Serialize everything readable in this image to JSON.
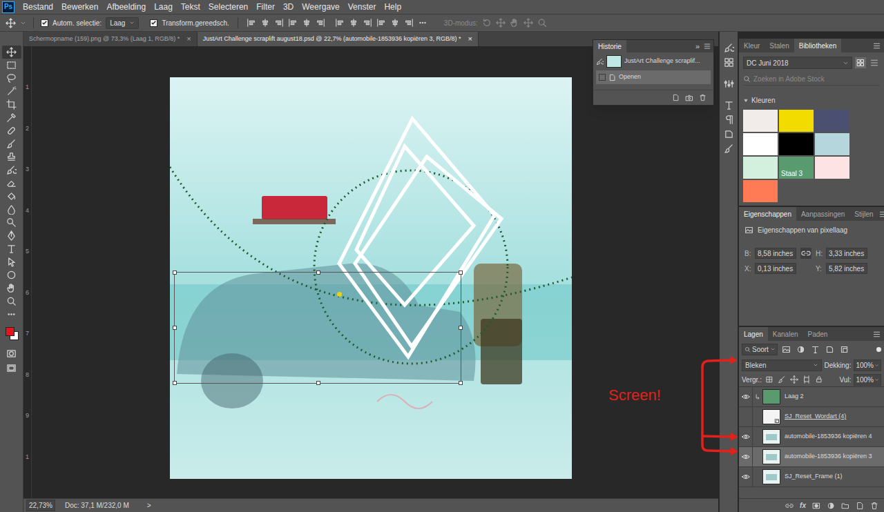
{
  "app": {
    "logo": "Ps"
  },
  "menu": [
    "Bestand",
    "Bewerken",
    "Afbeelding",
    "Laag",
    "Tekst",
    "Selecteren",
    "Filter",
    "3D",
    "Weergave",
    "Venster",
    "Help"
  ],
  "options_bar": {
    "auto_select": {
      "label": "Autom. selectie:",
      "checked": true
    },
    "target": "Laag",
    "transform_controls": {
      "label": "Transform.gereedsch.",
      "checked": true
    },
    "mode_3d": "3D-modus:"
  },
  "tool_colors": {
    "foreground": "#e8141b",
    "background": "#ffffff"
  },
  "document_tabs": [
    {
      "label": "Schermopname (159).png @ 73,3% (Laag 1, RGB/8) *",
      "close": "×",
      "selected": false
    },
    {
      "label": "JustArt Challenge scraplift august18.psd @ 22,7% (automobile-1853936 kopiëren 3, RGB/8) *",
      "close": "×",
      "selected": true
    }
  ],
  "ruler": [
    "1",
    "2",
    "3",
    "4",
    "5",
    "6",
    "7",
    "8",
    "9",
    "1"
  ],
  "history": {
    "title": "Historie",
    "collapse": "»",
    "items": [
      {
        "label": "JustArt Challenge scraplif...",
        "kind": "snapshot",
        "selected": false
      },
      {
        "label": "Openen",
        "kind": "state",
        "selected": true
      }
    ]
  },
  "status_bar": {
    "zoom": "22,73%",
    "document": "Doc: 37,1 M/232,0 M",
    "arrow": ">"
  },
  "libraries": {
    "tabs": [
      {
        "label": "Kleur",
        "selected": false
      },
      {
        "label": "Stalen",
        "selected": false
      },
      {
        "label": "Bibliotheken",
        "selected": true
      }
    ],
    "library": "DC Juni 2018",
    "search_placeholder": "Zoeken in Adobe Stock",
    "section": {
      "label": "Kleuren",
      "expanded": true
    },
    "swatches": [
      {
        "color": "#f1ebe9"
      },
      {
        "color": "#f2dc00"
      },
      {
        "color": "#4b5070"
      },
      {
        "color": "#ffffff"
      },
      {
        "color": "#000000"
      },
      {
        "color": "#b5d6dc"
      },
      {
        "color": "#d3f0df"
      },
      {
        "color": "#5a9a6f",
        "label": "Staal 3"
      },
      {
        "color": "#fde3e3"
      },
      {
        "color": "#ff7b56"
      }
    ]
  },
  "properties": {
    "tabs": [
      {
        "label": "Eigenschappen",
        "selected": true
      },
      {
        "label": "Aanpassingen",
        "selected": false
      },
      {
        "label": "Stijlen",
        "selected": false
      }
    ],
    "title": "Eigenschappen van pixellaag",
    "fields": [
      {
        "label": "B:",
        "value": "8,58 inches"
      },
      {
        "label": "H:",
        "value": "3,33 inches"
      },
      {
        "label": "X:",
        "value": "0,13 inches"
      },
      {
        "label": "Y:",
        "value": "5,82 inches"
      }
    ]
  },
  "layers": {
    "tabs": [
      {
        "label": "Lagen",
        "selected": true
      },
      {
        "label": "Kanalen",
        "selected": false
      },
      {
        "label": "Paden",
        "selected": false
      }
    ],
    "filter": "Soort",
    "blend_mode": "Bleken",
    "opacity_label": "Dekking:",
    "opacity": "100%",
    "lock_label": "Vergr.:",
    "fill_label": "Vul:",
    "fill": "100%",
    "fx": "fx",
    "items": [
      {
        "name": "Laag 2",
        "visible": true,
        "selected": false,
        "clipped": true,
        "linked": false,
        "kind": "fill"
      },
      {
        "name": "SJ_Reset_Wordart (4)",
        "visible": false,
        "selected": false,
        "clipped": false,
        "linked": true,
        "kind": "smart"
      },
      {
        "name": "automobile-1853936 kopiëren 4",
        "visible": true,
        "selected": false,
        "clipped": false,
        "linked": false,
        "kind": "pixel"
      },
      {
        "name": "automobile-1853936 kopiëren 3",
        "visible": true,
        "selected": true,
        "clipped": false,
        "linked": false,
        "kind": "pixel"
      },
      {
        "name": "SJ_Reset_Frame (1)",
        "visible": true,
        "selected": false,
        "clipped": false,
        "linked": false,
        "kind": "pixel"
      }
    ]
  },
  "annotation": {
    "text": "Screen!"
  }
}
